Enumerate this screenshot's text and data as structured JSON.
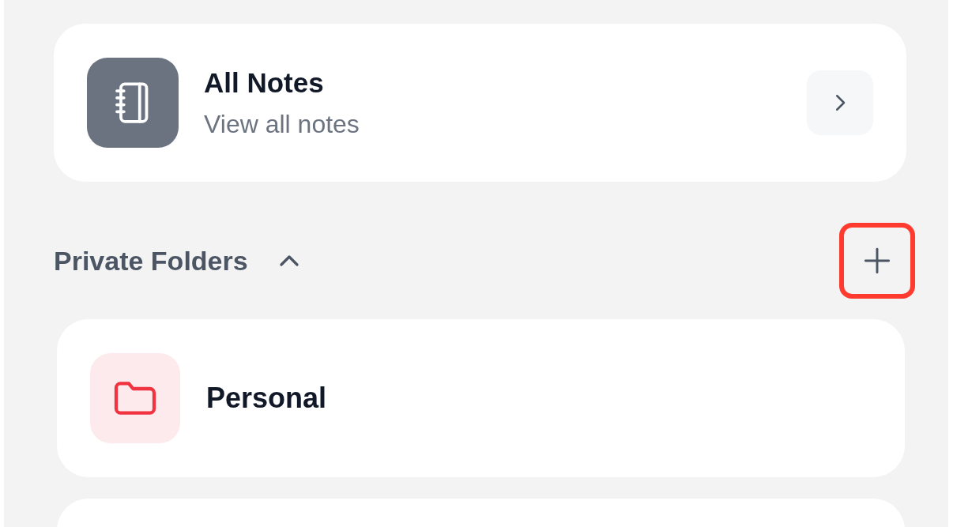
{
  "all_notes": {
    "title": "All Notes",
    "subtitle": "View all notes"
  },
  "private_folders": {
    "title": "Private Folders",
    "expanded": true,
    "add_highlighted": true,
    "folders": [
      {
        "name": "Personal",
        "color": "#ef3340"
      }
    ]
  }
}
